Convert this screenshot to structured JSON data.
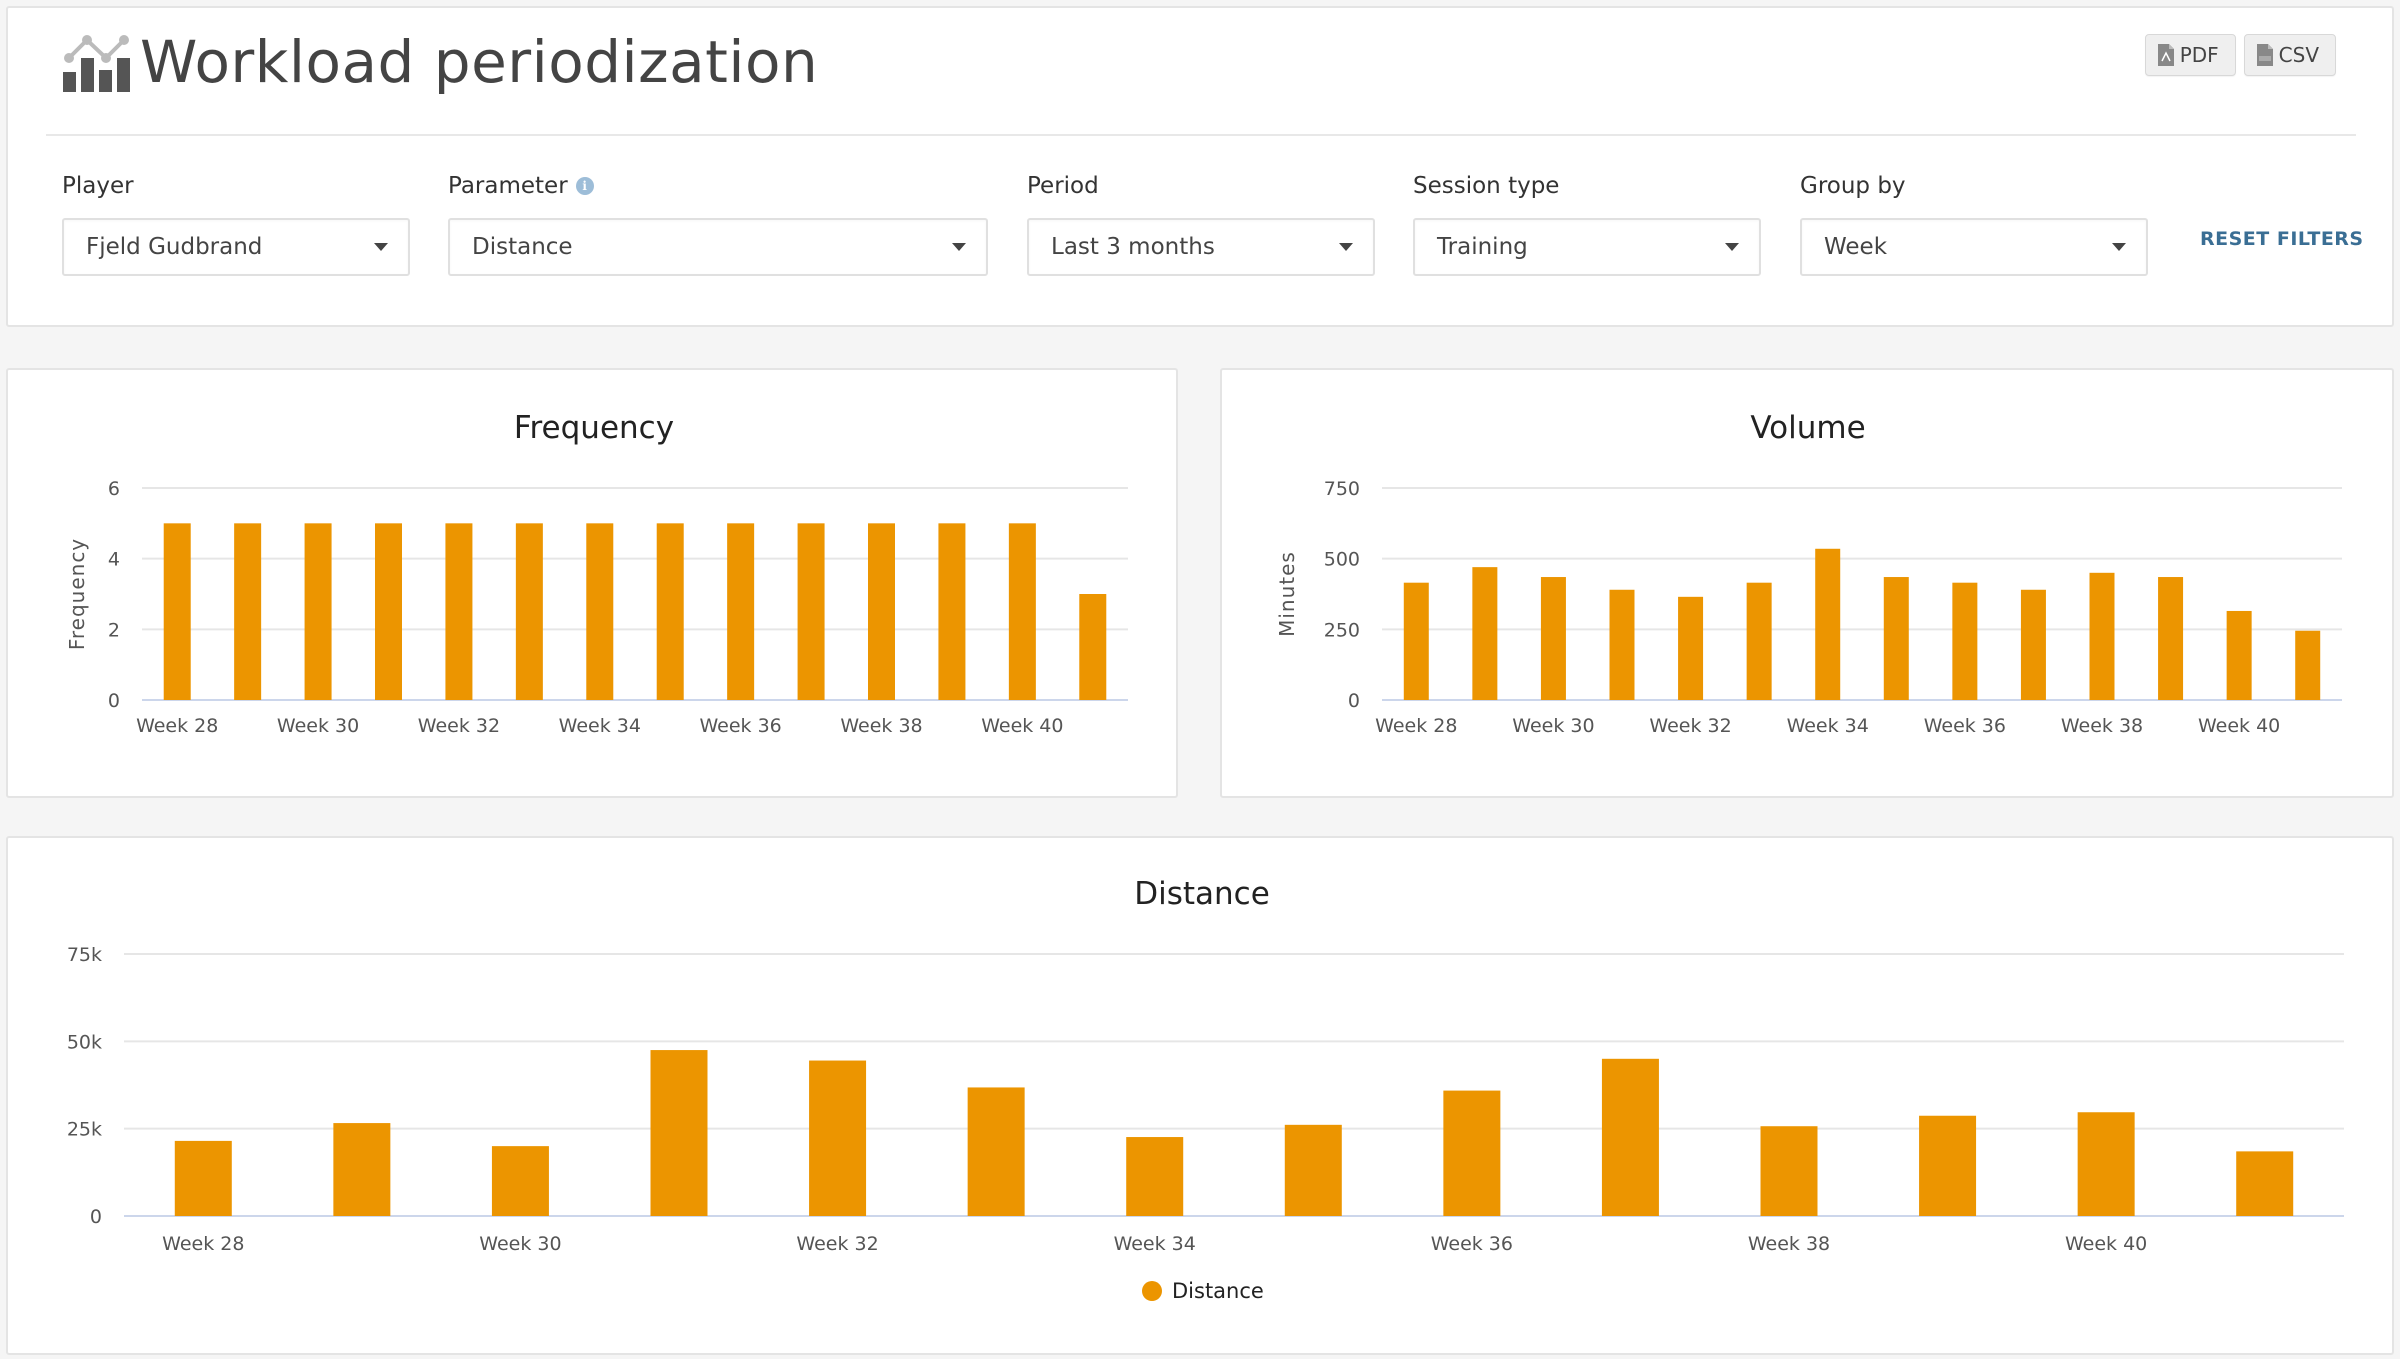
{
  "header": {
    "title": "Workload periodization",
    "title_icon": "chart-analytics-icon",
    "export_buttons": [
      {
        "label": "PDF",
        "icon": "pdf-file-icon"
      },
      {
        "label": "CSV",
        "icon": "csv-file-icon"
      }
    ]
  },
  "filters": {
    "player": {
      "label": "Player",
      "value": "Fjeld Gudbrand"
    },
    "parameter": {
      "label": "Parameter",
      "value": "Distance",
      "info_icon": "info-icon"
    },
    "period": {
      "label": "Period",
      "value": "Last 3 months"
    },
    "session_type": {
      "label": "Session type",
      "value": "Training"
    },
    "group_by": {
      "label": "Group by",
      "value": "Week"
    },
    "reset_label": "RESET FILTERS"
  },
  "colors": {
    "bar": "#ec9500",
    "grid": "#e6e6e6",
    "baseline": "#ccd6eb",
    "link": "#3a6e94"
  },
  "chart_data": [
    {
      "id": "frequency",
      "type": "bar",
      "title": "Frequency",
      "xlabel": "",
      "ylabel": "Frequency",
      "ylim": [
        0,
        6
      ],
      "yticks": [
        0,
        2,
        4,
        6
      ],
      "ytick_labels": [
        "0",
        "2",
        "4",
        "6"
      ],
      "categories": [
        "Week 28",
        "Week 29",
        "Week 30",
        "Week 31",
        "Week 32",
        "Week 33",
        "Week 34",
        "Week 35",
        "Week 36",
        "Week 37",
        "Week 38",
        "Week 39",
        "Week 40",
        "Week 41"
      ],
      "xtick_labels_shown": [
        "Week 28",
        "Week 30",
        "Week 32",
        "Week 34",
        "Week 36",
        "Week 38",
        "Week 40"
      ],
      "values": [
        5,
        5,
        5,
        5,
        5,
        5,
        5,
        5,
        5,
        5,
        5,
        5,
        5,
        3
      ],
      "grid": true,
      "legend": null
    },
    {
      "id": "volume",
      "type": "bar",
      "title": "Volume",
      "xlabel": "",
      "ylabel": "Minutes",
      "ylim": [
        0,
        750
      ],
      "yticks": [
        0,
        250,
        500,
        750
      ],
      "ytick_labels": [
        "0",
        "250",
        "500",
        "750"
      ],
      "categories": [
        "Week 28",
        "Week 29",
        "Week 30",
        "Week 31",
        "Week 32",
        "Week 33",
        "Week 34",
        "Week 35",
        "Week 36",
        "Week 37",
        "Week 38",
        "Week 39",
        "Week 40",
        "Week 41"
      ],
      "xtick_labels_shown": [
        "Week 28",
        "Week 30",
        "Week 32",
        "Week 34",
        "Week 36",
        "Week 38",
        "Week 40"
      ],
      "values": [
        415,
        470,
        435,
        390,
        365,
        415,
        535,
        435,
        415,
        390,
        450,
        435,
        315,
        245
      ],
      "grid": true,
      "legend": null
    },
    {
      "id": "distance",
      "type": "bar",
      "title": "Distance",
      "xlabel": "",
      "ylabel": "",
      "ylim": [
        0,
        75000
      ],
      "yticks": [
        0,
        25000,
        50000,
        75000
      ],
      "ytick_labels": [
        "0",
        "25k",
        "50k",
        "75k"
      ],
      "categories": [
        "Week 28",
        "Week 29",
        "Week 30",
        "Week 31",
        "Week 32",
        "Week 33",
        "Week 34",
        "Week 35",
        "Week 36",
        "Week 37",
        "Week 38",
        "Week 39",
        "Week 40",
        "Week 41"
      ],
      "xtick_labels_shown": [
        "Week 28",
        "Week 30",
        "Week 32",
        "Week 34",
        "Week 36",
        "Week 38",
        "Week 40"
      ],
      "values": [
        21500,
        26600,
        20000,
        47500,
        44500,
        36800,
        22600,
        26100,
        35900,
        45000,
        25700,
        28700,
        29700,
        18500
      ],
      "grid": true,
      "legend": {
        "position": "bottom-center",
        "entries": [
          {
            "name": "Distance",
            "marker": "circle"
          }
        ]
      }
    }
  ]
}
